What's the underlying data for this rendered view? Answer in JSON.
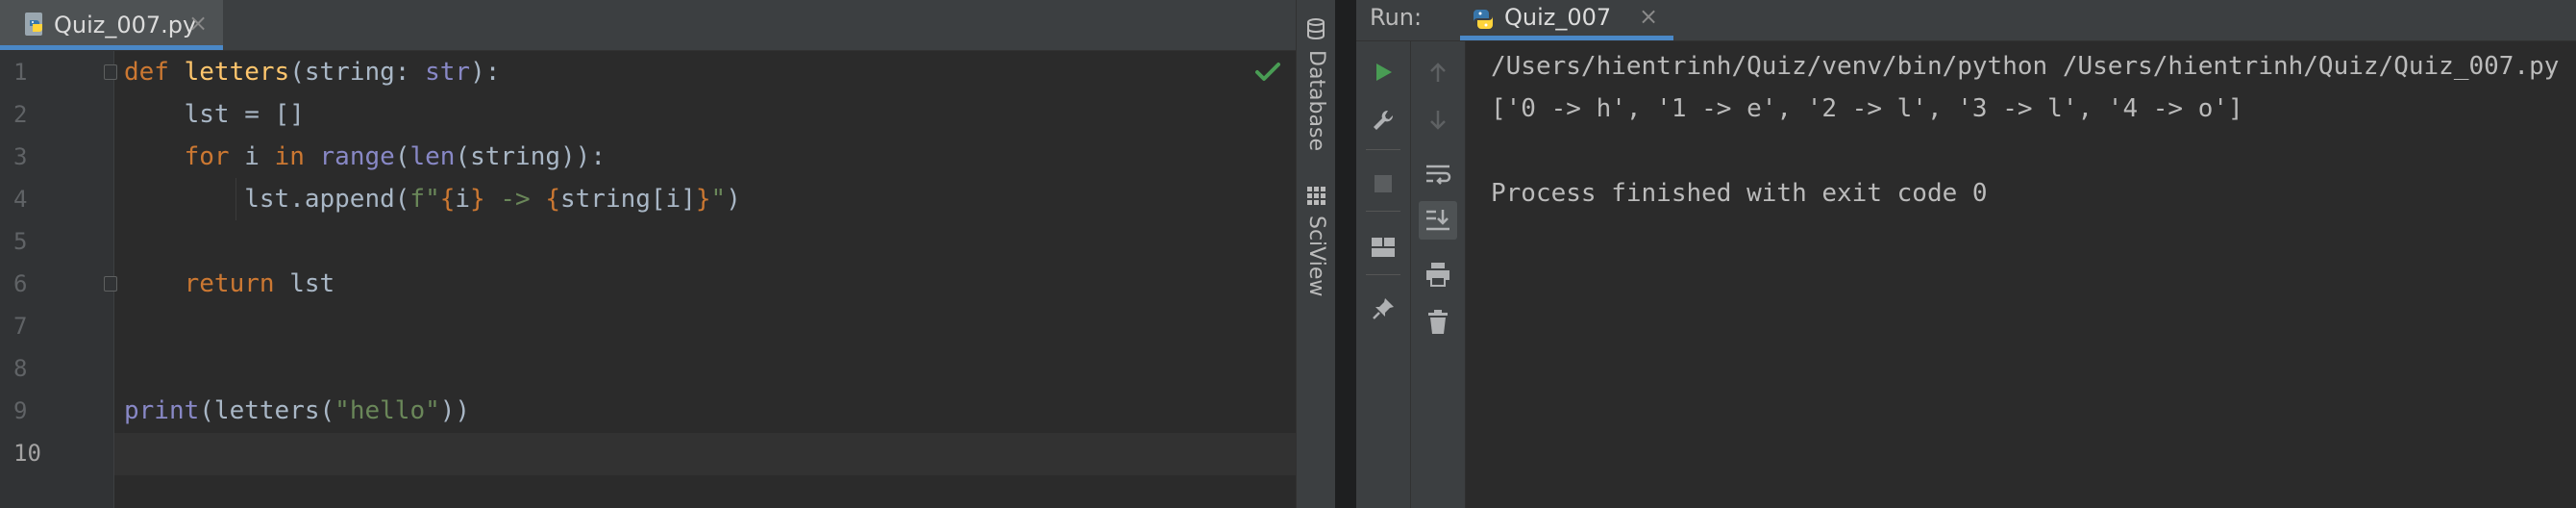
{
  "editor": {
    "tab": {
      "label": "Quiz_007.py",
      "close": "×",
      "icon": "python-file-icon"
    },
    "line_numbers": [
      "1",
      "2",
      "3",
      "4",
      "5",
      "6",
      "7",
      "8",
      "9",
      "10"
    ],
    "code": {
      "l1": {
        "kw": "def",
        "fn": "letters",
        "open": "(string: ",
        "type": "str",
        "close": "):"
      },
      "l2": {
        "text": "    lst = []"
      },
      "l3": {
        "indent": "    ",
        "kw_for": "for",
        "var": " i ",
        "kw_in": "in",
        "sp": " ",
        "range": "range",
        "p1": "(",
        "len": "len",
        "rest": "(string)):"
      },
      "l4": {
        "pre": "        lst.append(",
        "fprefix": "f\"",
        "b1": "{",
        "v1": "i",
        "b2": "}",
        "mid": " -> ",
        "b3": "{",
        "v2": "string[i]",
        "b4": "}",
        "q": "\"",
        "end": ")"
      },
      "l6": {
        "indent": "    ",
        "kw": "return",
        "rest": " lst"
      },
      "l9": {
        "print": "print",
        "mid": "(letters(",
        "str": "\"hello\"",
        "end": "))"
      }
    },
    "inspection_status": "check-icon"
  },
  "tool_strip": {
    "database": {
      "label": "Database",
      "icon": "database-icon"
    },
    "sciview": {
      "label": "SciView",
      "icon": "sciview-icon"
    }
  },
  "run": {
    "label": "Run:",
    "tab": {
      "label": "Quiz_007",
      "close": "×",
      "icon": "python-run-icon"
    },
    "toolbar_left": [
      "rerun-icon",
      "settings-wrench-icon",
      "stop-icon",
      "layout-icon",
      "pin-icon"
    ],
    "toolbar_right": [
      "up-arrow-icon",
      "down-arrow-icon",
      "soft-wrap-icon",
      "scroll-to-end-icon",
      "print-icon",
      "trash-icon"
    ],
    "output": {
      "command": "/Users/hientrinh/Quiz/venv/bin/python /Users/hientrinh/Quiz/Quiz_007.py",
      "result": "['0 -> h', '1 -> e', '2 -> l', '3 -> l', '4 -> o']",
      "blank": "",
      "exit": "Process finished with exit code 0"
    }
  },
  "colors": {
    "keyword": "#cc7832",
    "function": "#ffc66d",
    "builtin": "#8888c6",
    "string": "#6a8759",
    "default_text": "#a9b7c6",
    "run_green": "#499c54",
    "accent": "#4a88c7"
  }
}
